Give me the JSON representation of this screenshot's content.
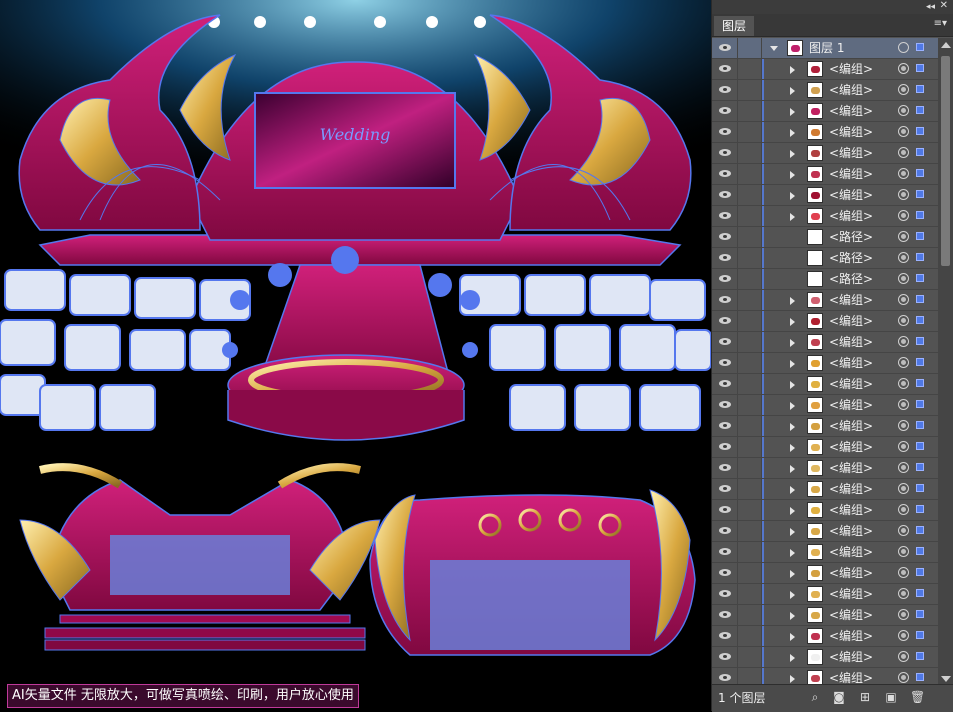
{
  "panel": {
    "tab_title": "图层",
    "collapse_icon": "double-chevron-icon",
    "close_icon": "close-icon",
    "menu_icon": "panel-menu-icon",
    "top_layer": {
      "name": "图层 1",
      "expanded": true
    },
    "items": [
      {
        "name": "<编组>",
        "type": "group",
        "thumb": "#b0203a"
      },
      {
        "name": "<编组>",
        "type": "group",
        "thumb": "#d0a050"
      },
      {
        "name": "<编组>",
        "type": "group",
        "thumb": "#c02060"
      },
      {
        "name": "<编组>",
        "type": "group",
        "thumb": "#d07a30"
      },
      {
        "name": "<编组>",
        "type": "group",
        "thumb": "#b04040"
      },
      {
        "name": "<编组>",
        "type": "group",
        "thumb": "#c03050"
      },
      {
        "name": "<编组>",
        "type": "group",
        "thumb": "#a01030"
      },
      {
        "name": "<编组>",
        "type": "group",
        "thumb": "#e04050"
      },
      {
        "name": "<路径>",
        "type": "path",
        "thumb": "#ffffff"
      },
      {
        "name": "<路径>",
        "type": "path",
        "thumb": "#ffffff"
      },
      {
        "name": "<路径>",
        "type": "path",
        "thumb": "#ffffff"
      },
      {
        "name": "<编组>",
        "type": "group",
        "thumb": "#d06070"
      },
      {
        "name": "<编组>",
        "type": "group",
        "thumb": "#b02030"
      },
      {
        "name": "<编组>",
        "type": "group",
        "thumb": "#c04050"
      },
      {
        "name": "<编组>",
        "type": "group",
        "thumb": "#e0a030"
      },
      {
        "name": "<编组>",
        "type": "group",
        "thumb": "#e0b040"
      },
      {
        "name": "<编组>",
        "type": "group",
        "thumb": "#e0a040"
      },
      {
        "name": "<编组>",
        "type": "group",
        "thumb": "#d4a040"
      },
      {
        "name": "<编组>",
        "type": "group",
        "thumb": "#e0b050"
      },
      {
        "name": "<编组>",
        "type": "group",
        "thumb": "#e0b860"
      },
      {
        "name": "<编组>",
        "type": "group",
        "thumb": "#d8a848"
      },
      {
        "name": "<编组>",
        "type": "group",
        "thumb": "#e0b040"
      },
      {
        "name": "<编组>",
        "type": "group",
        "thumb": "#d8a848"
      },
      {
        "name": "<编组>",
        "type": "group",
        "thumb": "#e0b050"
      },
      {
        "name": "<编组>",
        "type": "group",
        "thumb": "#d4a040"
      },
      {
        "name": "<编组>",
        "type": "group",
        "thumb": "#e0b050"
      },
      {
        "name": "<编组>",
        "type": "group",
        "thumb": "#d8a848"
      },
      {
        "name": "<编组>",
        "type": "group",
        "thumb": "#c03050"
      },
      {
        "name": "<编组>",
        "type": "group",
        "thumb": "#f0f0f0"
      },
      {
        "name": "<编组>",
        "type": "group",
        "thumb": "#c04050"
      },
      {
        "name": "<编组>",
        "type": "group",
        "thumb": "#d06070"
      }
    ],
    "footer": {
      "layer_count": "1 个图层",
      "icons": [
        "locate-object-icon",
        "make-clipping-mask-icon",
        "new-sublayer-icon",
        "new-layer-icon",
        "delete-icon"
      ]
    }
  },
  "canvas": {
    "caption": "AI矢量文件 无限放大，可做写真喷绘、印刷，用户放心使用"
  },
  "colors": {
    "selection": "#5577ee",
    "magenta": "#b0105e",
    "gold": "#d9b25a",
    "panel_bg": "#535353"
  }
}
